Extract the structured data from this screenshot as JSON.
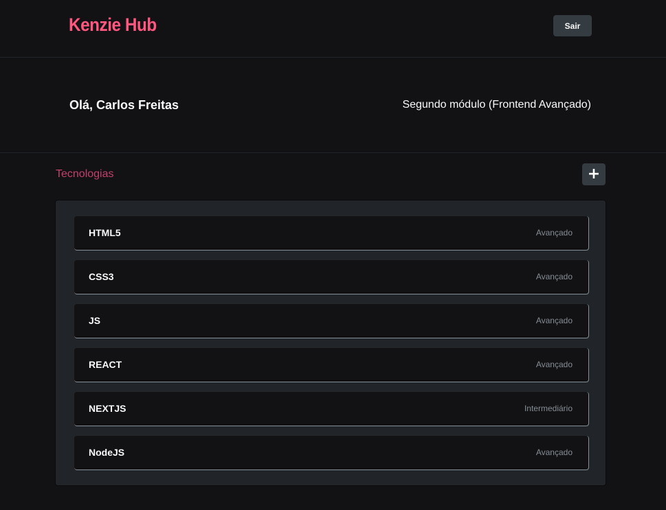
{
  "header": {
    "logo": "Kenzie Hub",
    "logout_label": "Sair"
  },
  "user": {
    "greeting": "Olá, Carlos Freitas",
    "module": "Segundo módulo (Frontend Avançado)"
  },
  "technologies": {
    "title": "Tecnologias",
    "add_label": "+",
    "items": [
      {
        "name": "HTML5",
        "status": "Avançado"
      },
      {
        "name": "CSS3",
        "status": "Avançado"
      },
      {
        "name": "JS",
        "status": "Avançado"
      },
      {
        "name": "REACT",
        "status": "Avançado"
      },
      {
        "name": "NEXTJS",
        "status": "Intermediário"
      },
      {
        "name": "NodeJS",
        "status": "Avançado"
      }
    ]
  },
  "colors": {
    "brand": "#FF577F",
    "background": "#121214",
    "panel": "#212529",
    "button": "#343B41",
    "muted_text": "#868E96"
  },
  "icons": {
    "add": "plus-icon"
  }
}
